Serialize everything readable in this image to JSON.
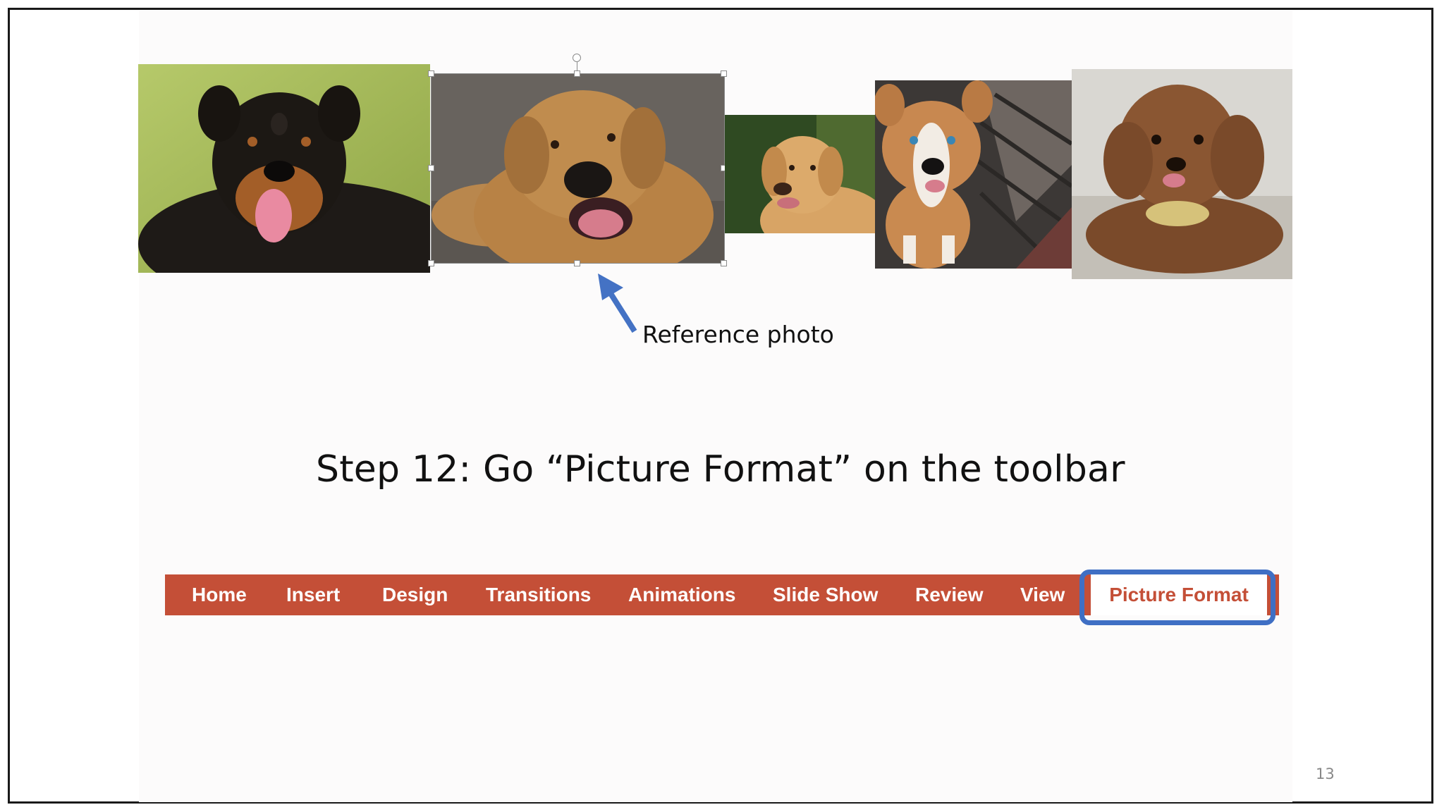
{
  "slide": {
    "caption": "Reference photo",
    "heading": "Step 12: Go “Picture Format” on the toolbar",
    "page_number": "13"
  },
  "toolbar": {
    "tabs": [
      "Home",
      "Insert",
      "Design",
      "Transitions",
      "Animations",
      "Slide Show",
      "Review",
      "View"
    ],
    "active_tab": "Picture Format"
  },
  "photos": [
    {
      "name": "rottweiler-photo"
    },
    {
      "name": "golden-retriever-photo",
      "selected": true
    },
    {
      "name": "labrador-photo"
    },
    {
      "name": "pitbull-puppy-photo"
    },
    {
      "name": "poodle-photo"
    }
  ],
  "colors": {
    "toolbar": "#c44f37",
    "highlight": "#3f6fc4",
    "arrow": "#4472c4"
  }
}
